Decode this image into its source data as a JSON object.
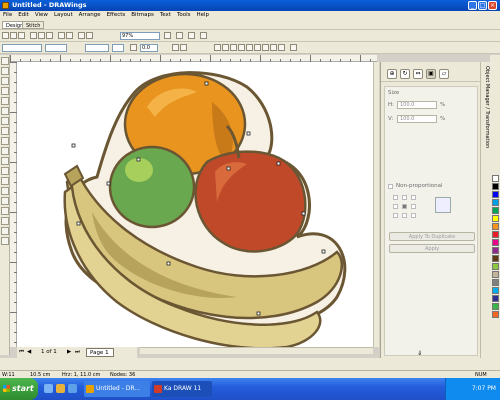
{
  "window": {
    "title": "Untitled - DRAWings"
  },
  "menu": [
    "File",
    "Edit",
    "View",
    "Layout",
    "Arrange",
    "Effects",
    "Bitmaps",
    "Text",
    "Tools",
    "Help"
  ],
  "toolbar": {
    "tabs": [
      "Design",
      "Stitch"
    ],
    "zoom_value": "97%",
    "angle_value": "0.0"
  },
  "page_nav": {
    "page_count": "1 of 1",
    "page_tab": "Page 1"
  },
  "docker": {
    "size_label": "Size",
    "x_label": "H:",
    "x_value": "100.0",
    "x_unit": "%",
    "y_label": "V:",
    "y_value": "100.0",
    "y_unit": "%",
    "proportional_label": "Non-proportional",
    "apply_duplicate_label": "Apply To Duplicate",
    "apply_label": "Apply",
    "side_tab_label": "Object Manager / Transformation"
  },
  "status": {
    "width": "W:11",
    "height": "10.5 cm",
    "position": "Hrz: 1, 11.0 cm",
    "nodes": "Nodes: 36",
    "mode": "NUM"
  },
  "taskbar": {
    "start_label": "start",
    "tasks": [
      "Untitled - DR...",
      "Ka DRAW 11"
    ],
    "clock": "7:07 PM"
  },
  "colors": {
    "orange": "#e8941f",
    "apple_red": "#c0492a",
    "lime_green": "#6aa84f",
    "banana": "#d8c57e",
    "outline": "#6b5633"
  }
}
